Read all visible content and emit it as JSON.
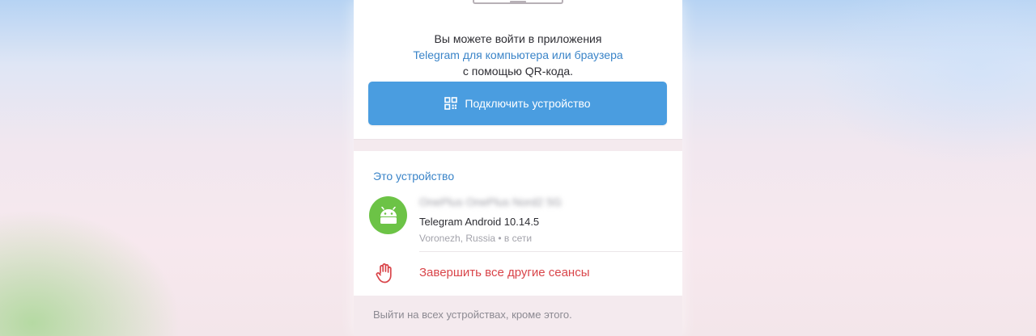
{
  "qr_section": {
    "line1": "Вы можете войти в приложения",
    "line2": "Telegram для компьютера или браузера",
    "line3": "с помощью QR-кода.",
    "connect_button": "Подключить устройство"
  },
  "this_device": {
    "title": "Это устройство",
    "name": "OnePlus OnePlus Nord2 5G",
    "app": "Telegram Android 10.14.5",
    "location": "Voronezh, Russia • в сети",
    "avatar_icon": "android-icon"
  },
  "terminate": {
    "label": "Завершить все другие сеансы",
    "icon": "hand-stop-icon"
  },
  "footer": {
    "text": "Выйти на всех устройствах, кроме этого."
  },
  "colors": {
    "accent": "#4a9de0",
    "link": "#3a84c8",
    "danger": "#d9454a",
    "android_green": "#6cc346"
  }
}
